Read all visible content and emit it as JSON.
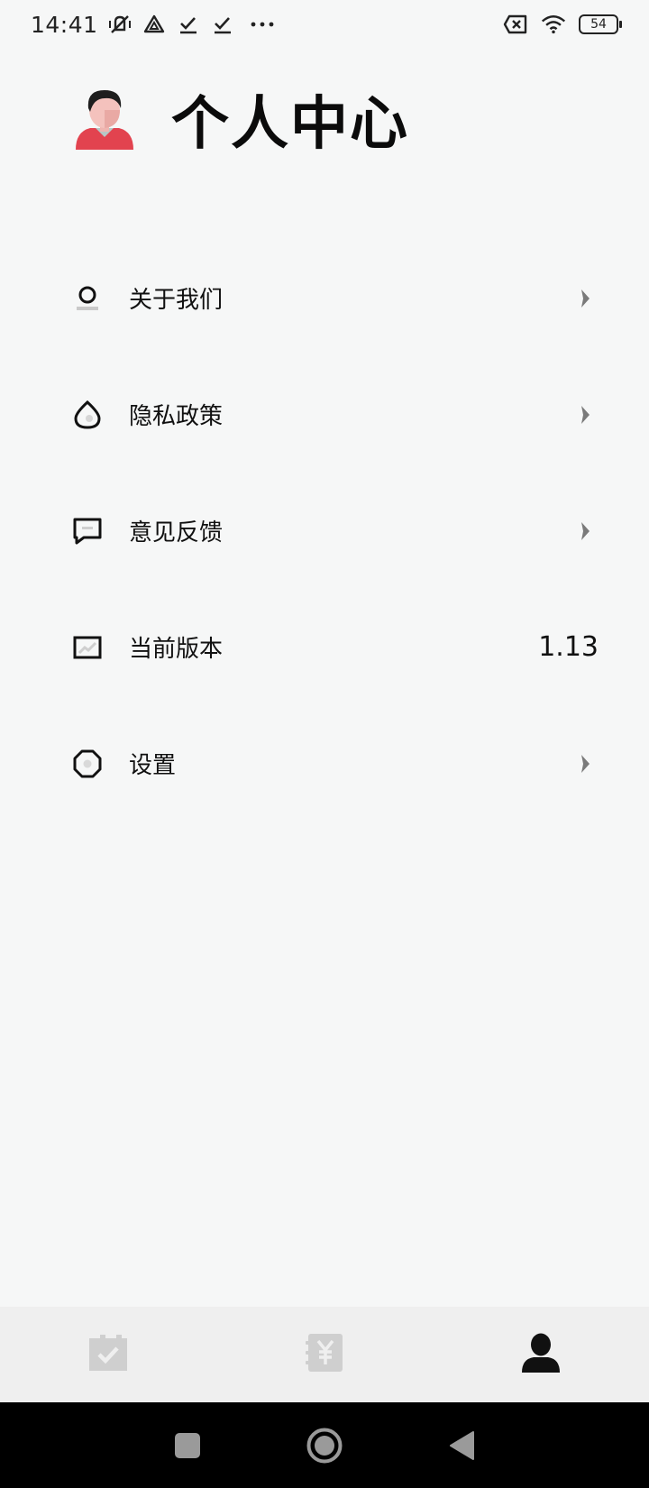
{
  "status_bar": {
    "time": "14:41",
    "battery": "54",
    "icons": [
      "mute-vibrate-icon",
      "drive-icon",
      "check-icon",
      "check-icon",
      "more-dots-icon",
      "sim-off-icon",
      "wifi-icon",
      "battery-icon"
    ]
  },
  "header": {
    "title": "个人中心",
    "avatar_icon": "user-avatar-icon"
  },
  "menu": {
    "items": [
      {
        "label": "关于我们",
        "icon": "person-outline-icon",
        "trailing": "chevron"
      },
      {
        "label": "隐私政策",
        "icon": "drop-icon",
        "trailing": "chevron"
      },
      {
        "label": "意见反馈",
        "icon": "message-icon",
        "trailing": "chevron"
      },
      {
        "label": "当前版本",
        "icon": "monitor-chart-icon",
        "trailing": "value",
        "value": "1.13"
      },
      {
        "label": "设置",
        "icon": "octagon-icon",
        "trailing": "chevron"
      }
    ]
  },
  "tab_bar": {
    "tabs": [
      {
        "icon": "calendar-check-icon",
        "active": false
      },
      {
        "icon": "yuan-notebook-icon",
        "active": false
      },
      {
        "icon": "user-icon",
        "active": true
      }
    ],
    "active_color": "#111111",
    "inactive_color": "#cfcfcf"
  },
  "nav_bar": {
    "buttons": [
      "recent-apps-icon",
      "home-icon",
      "back-icon"
    ]
  }
}
